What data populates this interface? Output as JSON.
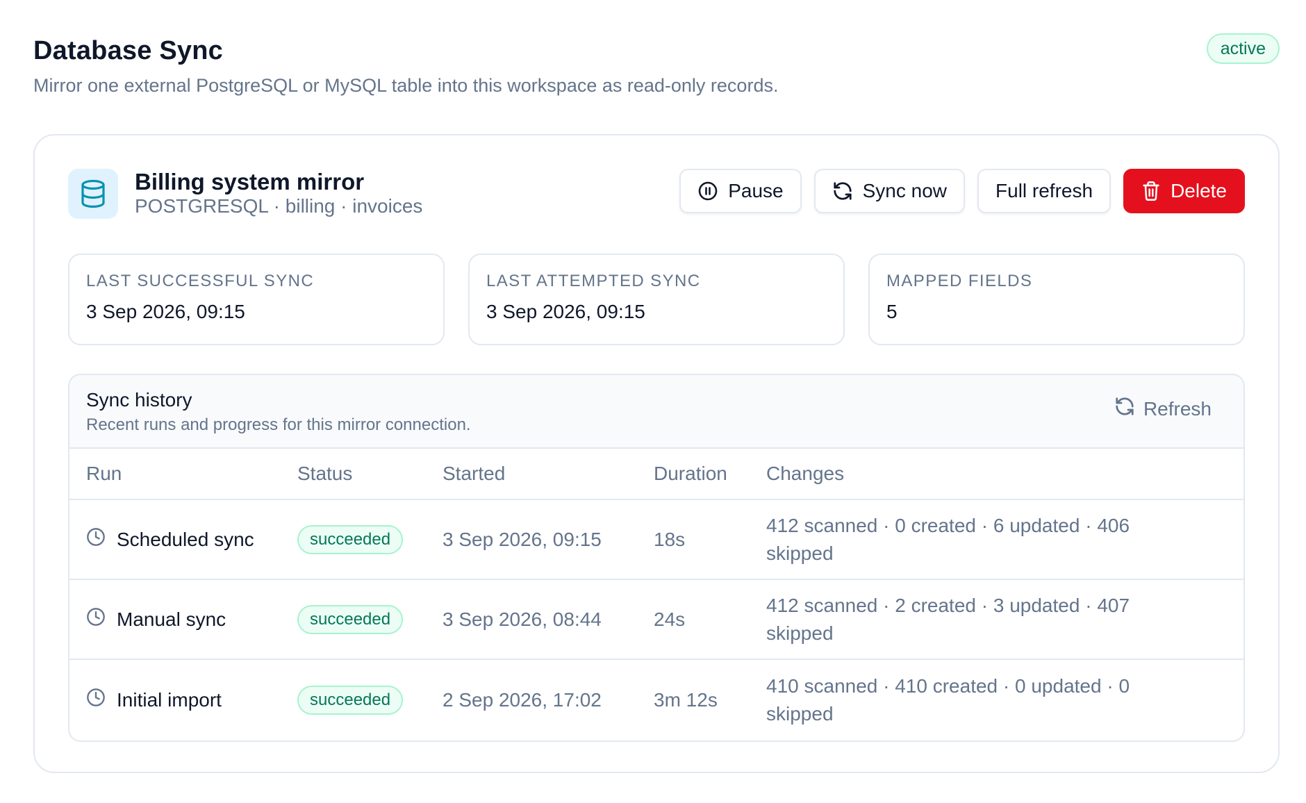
{
  "header": {
    "title": "Database Sync",
    "subtitle": "Mirror one external PostgreSQL or MySQL table into this workspace as read-only records.",
    "status": "active"
  },
  "connection": {
    "icon": "database-icon",
    "name": "Billing system mirror",
    "meta": "POSTGRESQL · billing · invoices",
    "actions": {
      "pause": "Pause",
      "sync_now": "Sync now",
      "full_refresh": "Full refresh",
      "delete": "Delete"
    }
  },
  "stats": [
    {
      "label": "LAST SUCCESSFUL SYNC",
      "value": "3 Sep 2026, 09:15"
    },
    {
      "label": "LAST ATTEMPTED SYNC",
      "value": "3 Sep 2026, 09:15"
    },
    {
      "label": "MAPPED FIELDS",
      "value": "5"
    }
  ],
  "history": {
    "title": "Sync history",
    "subtitle": "Recent runs and progress for this mirror connection.",
    "refresh_label": "Refresh",
    "columns": {
      "run": "Run",
      "status": "Status",
      "started": "Started",
      "duration": "Duration",
      "changes": "Changes"
    },
    "rows": [
      {
        "run": "Scheduled sync",
        "status": "succeeded",
        "started": "3 Sep 2026, 09:15",
        "duration": "18s",
        "changes": "412 scanned · 0 created · 6 updated · 406 skipped"
      },
      {
        "run": "Manual sync",
        "status": "succeeded",
        "started": "3 Sep 2026, 08:44",
        "duration": "24s",
        "changes": "412 scanned · 2 created · 3 updated · 407 skipped"
      },
      {
        "run": "Initial import",
        "status": "succeeded",
        "started": "2 Sep 2026, 17:02",
        "duration": "3m 12s",
        "changes": "410 scanned · 410 created · 0 updated · 0 skipped"
      }
    ]
  },
  "colors": {
    "accent_cyan": "#0891b2",
    "success_text": "#047857",
    "success_bg": "#ecfdf5",
    "danger": "#e5101d",
    "muted": "#64748b"
  }
}
